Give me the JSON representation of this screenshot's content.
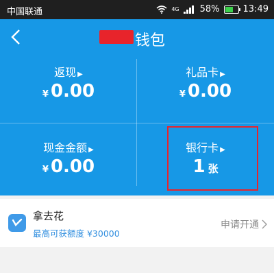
{
  "status_bar": {
    "carrier": "中国联通",
    "network": "4G",
    "battery": "58%",
    "time": "13:49"
  },
  "header": {
    "title_suffix": "钱包"
  },
  "cards": [
    {
      "label": "返现",
      "currency": "¥",
      "value": "0.00"
    },
    {
      "label": "礼品卡",
      "currency": "¥",
      "value": "0.00"
    },
    {
      "label": "现金金额",
      "currency": "¥",
      "value": "0.00"
    },
    {
      "label": "银行卡",
      "value": "1",
      "unit": "张"
    }
  ],
  "promo": {
    "name": "拿去花",
    "subtitle": "最高可获额度 ¥30000",
    "action": "申请开通"
  },
  "colors": {
    "primary": "#1798e6",
    "highlight": "#e8242b",
    "link": "#2e8ddf"
  }
}
